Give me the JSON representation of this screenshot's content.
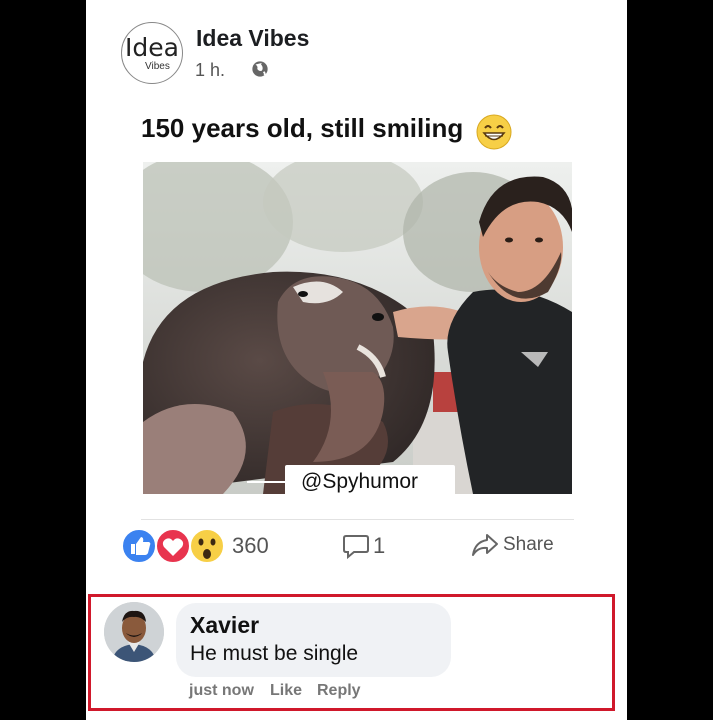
{
  "post": {
    "page_logo": {
      "line1": "Idea",
      "line2": "Vibes"
    },
    "page_name": "Idea Vibes",
    "time": "1 h.",
    "privacy_icon": "globe-icon",
    "text": "150 years old, still smiling",
    "text_emoji": "grinning-face-emoji",
    "photo": {
      "description_icon": "photo-tortoise-selfie",
      "watermark": "@Spyhumor"
    }
  },
  "stats": {
    "reaction_icons": [
      "like-icon",
      "love-icon",
      "wow-icon"
    ],
    "reaction_count": "360",
    "comment_count": "1",
    "share_label": "Share"
  },
  "comment": {
    "author": "Xavier",
    "text": "He must be single",
    "time": "just now",
    "like_label": "Like",
    "reply_label": "Reply",
    "highlight_color": "#d0182b"
  }
}
